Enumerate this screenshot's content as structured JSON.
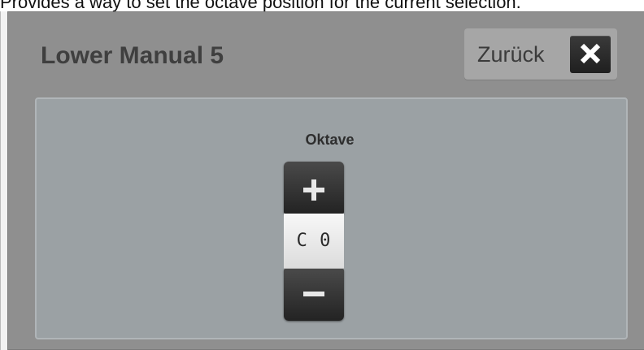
{
  "caption": "Provides a way to set the octave position for the current selection.",
  "dialog": {
    "title": "Lower Manual 5",
    "back_label": "Zurück",
    "close_icon": "close-icon"
  },
  "octave": {
    "label": "Oktave",
    "value": "C 0",
    "increment_icon": "plus-icon",
    "decrement_icon": "minus-icon"
  },
  "colors": {
    "dialog_background": "#8f8f8f",
    "panel_background": "#9ba1a4",
    "button_dark": "#2a2a2a",
    "value_background": "#ececec"
  }
}
